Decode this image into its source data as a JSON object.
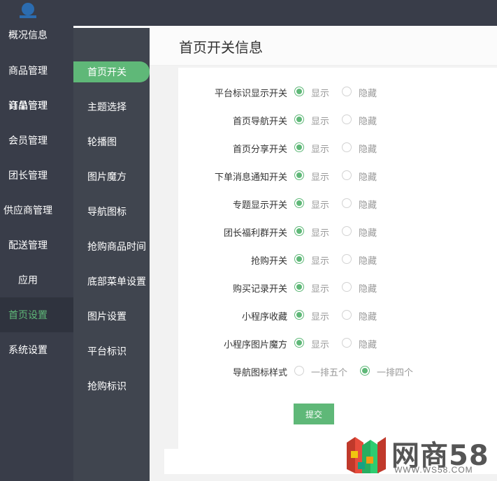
{
  "sidebar_main": {
    "items": [
      {
        "label": "概况信息",
        "active": false
      },
      {
        "label": "商品管理",
        "active": false
      },
      {
        "label": "订单管理",
        "active": false
      },
      {
        "label": "会员管理",
        "active": false
      },
      {
        "label": "团长管理",
        "active": false
      },
      {
        "label": "供应商管理",
        "active": false
      },
      {
        "label": "配送管理",
        "active": false
      },
      {
        "label": "应用",
        "active": false
      },
      {
        "label": "首页设置",
        "active": true
      },
      {
        "label": "系统设置",
        "active": false
      }
    ]
  },
  "sidebar_sub": {
    "items": [
      {
        "label": "首页开关",
        "active": true
      },
      {
        "label": "主题选择",
        "active": false
      },
      {
        "label": "轮播图",
        "active": false
      },
      {
        "label": "图片魔方",
        "active": false
      },
      {
        "label": "导航图标",
        "active": false
      },
      {
        "label": "抢购商品时间",
        "active": false
      },
      {
        "label": "底部菜单设置",
        "active": false
      },
      {
        "label": "图片设置",
        "active": false
      },
      {
        "label": "平台标识",
        "active": false
      },
      {
        "label": "抢购标识",
        "active": false
      }
    ]
  },
  "page": {
    "title": "首页开关信息"
  },
  "form": {
    "rows": [
      {
        "label": "平台标识显示开关",
        "options": [
          "显示",
          "隐藏"
        ],
        "selected": 0
      },
      {
        "label": "首页导航开关",
        "options": [
          "显示",
          "隐藏"
        ],
        "selected": 0
      },
      {
        "label": "首页分享开关",
        "options": [
          "显示",
          "隐藏"
        ],
        "selected": 0
      },
      {
        "label": "下单消息通知开关",
        "options": [
          "显示",
          "隐藏"
        ],
        "selected": 0
      },
      {
        "label": "专题显示开关",
        "options": [
          "显示",
          "隐藏"
        ],
        "selected": 0
      },
      {
        "label": "团长福利群开关",
        "options": [
          "显示",
          "隐藏"
        ],
        "selected": 0
      },
      {
        "label": "抢购开关",
        "options": [
          "显示",
          "隐藏"
        ],
        "selected": 0
      },
      {
        "label": "购买记录开关",
        "options": [
          "显示",
          "隐藏"
        ],
        "selected": 0
      },
      {
        "label": "小程序收藏",
        "options": [
          "显示",
          "隐藏"
        ],
        "selected": 0
      },
      {
        "label": "小程序图片魔方",
        "options": [
          "显示",
          "隐藏"
        ],
        "selected": 0
      },
      {
        "label": "导航图标样式",
        "options": [
          "一排五个",
          "一排四个"
        ],
        "selected": 1
      }
    ],
    "submit_label": "提交"
  },
  "watermark": {
    "brand": "网商58",
    "url": "WWW.WS58.COM"
  },
  "colors": {
    "accent": "#5fb878",
    "sidebar": "#393d49",
    "subsidebar": "#40454f"
  }
}
